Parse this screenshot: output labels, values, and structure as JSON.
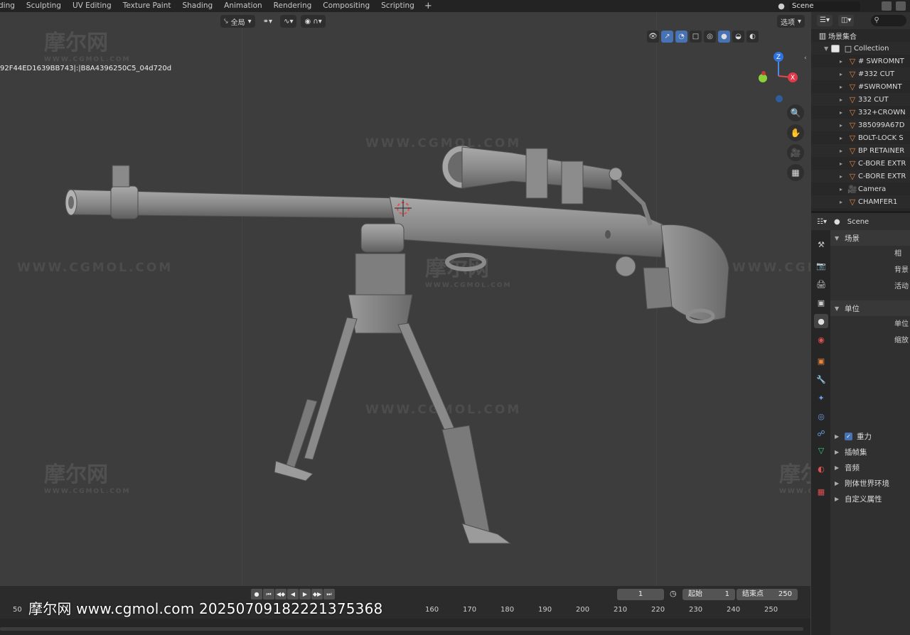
{
  "topbar": {
    "tabs": [
      "ding",
      "Sculpting",
      "UV Editing",
      "Texture Paint",
      "Shading",
      "Animation",
      "Rendering",
      "Compositing",
      "Scripting"
    ],
    "add_label": "+",
    "scene_name": "Scene"
  },
  "viewport": {
    "transform_orientation": "全局",
    "options_label": "选项",
    "object_name": "92F44ED1639BB743|:|B8A4396250C5_04d720d",
    "watermark_text": "WWW.CGMOL.COM",
    "watermark_logo": "摩尔网",
    "watermark_logo_sub": "WWW.CGMOL.COM",
    "axis_z": "Z",
    "axis_x": "X",
    "active_shading": "solid"
  },
  "outliner": {
    "root_label": "场景集合",
    "items": [
      {
        "label": "Collection",
        "kind": "collection"
      },
      {
        "label": "# SWROMNT",
        "kind": "mesh"
      },
      {
        "label": "#332 CUT",
        "kind": "mesh"
      },
      {
        "label": "#SWROMNT",
        "kind": "mesh"
      },
      {
        "label": "332 CUT",
        "kind": "mesh"
      },
      {
        "label": "332+CROWN",
        "kind": "mesh"
      },
      {
        "label": "385099A67D",
        "kind": "mesh"
      },
      {
        "label": "BOLT-LOCK S",
        "kind": "mesh"
      },
      {
        "label": "BP RETAINER",
        "kind": "mesh"
      },
      {
        "label": "C-BORE EXTR",
        "kind": "mesh"
      },
      {
        "label": "C-BORE EXTR",
        "kind": "mesh"
      },
      {
        "label": "Camera",
        "kind": "camera"
      },
      {
        "label": "CHAMFER1",
        "kind": "mesh"
      }
    ]
  },
  "properties": {
    "header_label": "Scene",
    "scene_section": "场景",
    "scene_fields": [
      "相",
      "背景",
      "活动"
    ],
    "units_section": "单位",
    "units_fields": [
      "单位",
      "缩放"
    ],
    "gravity_label": "重力",
    "sections": [
      "插帧集",
      "音频",
      "刚体世界环境",
      "自定义属性"
    ]
  },
  "timeline": {
    "current_frame": "1",
    "start_label": "起始",
    "start_value": "1",
    "end_label": "结束点",
    "end_value": "250",
    "ticks": [
      "50",
      "160",
      "170",
      "180",
      "190",
      "200",
      "210",
      "220",
      "230",
      "240",
      "250"
    ]
  },
  "caption": "摩尔网 www.cgmol.com 20250709182221375368"
}
